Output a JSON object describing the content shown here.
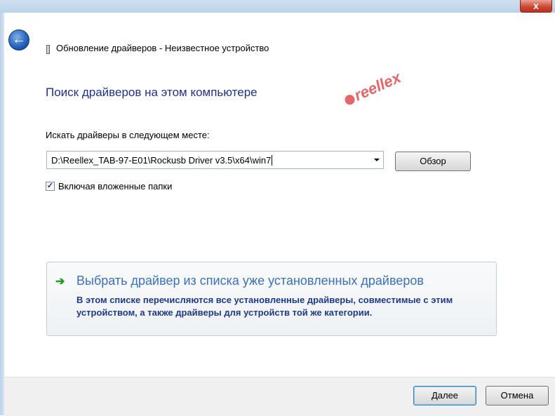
{
  "window": {
    "close_glyph": "x",
    "title": "Обновление драйверов - Неизвестное устройство"
  },
  "watermark": "reellex",
  "page": {
    "heading": "Поиск драйверов на этом компьютере",
    "search_label": "Искать драйверы в следующем месте:",
    "path_value": "D:\\Reellex_TAB-97-E01\\Rockusb Driver v3.5\\x64\\win7",
    "browse_label": "Обзор",
    "include_subfolders_label": "Включая вложенные папки",
    "include_subfolders_checked": true
  },
  "option": {
    "title": "Выбрать драйвер из списка уже установленных драйверов",
    "description": "В этом списке перечисляются все установленные драйверы, совместимые с этим устройством, а также драйверы для устройств той же категории."
  },
  "footer": {
    "next_label": "Далее",
    "cancel_label": "Отмена"
  },
  "icons": {
    "back": "back-arrow-icon",
    "device": "device-icon",
    "option_arrow": "green-arrow-icon"
  },
  "colors": {
    "heading": "#1e3287",
    "option_title": "#3c71b8",
    "watermark": "#e3565a"
  }
}
